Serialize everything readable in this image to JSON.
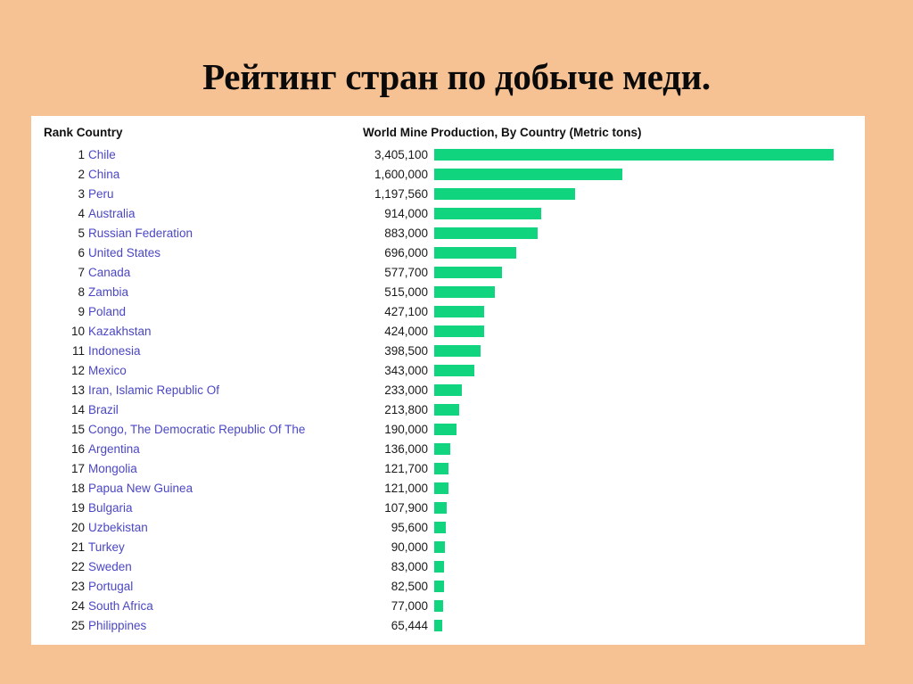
{
  "title": "Рейтинг стран по добыче меди.",
  "panel": {
    "headers": {
      "rank_country": "Rank Country",
      "production": "World Mine Production, By Country (Metric tons)"
    }
  },
  "colors": {
    "background": "#f7c293",
    "panel": "#ffffff",
    "bar": "#11d47e",
    "country_text": "#4b47c4",
    "value_text": "#1a1a1a",
    "header_text": "#111111",
    "title_text": "#0a0a0a"
  },
  "chart_data": {
    "type": "bar",
    "title": "Рейтинг стран по добыче меди.",
    "subtitle": "",
    "xlabel": "",
    "ylabel": "",
    "orientation": "horizontal",
    "grid": false,
    "legend": null,
    "value_header": "World Mine Production, By Country (Metric tons)",
    "category_header": "Rank Country",
    "units": "Metric tons",
    "xlim": [
      0,
      3405100
    ],
    "bar_color": "#11d47e",
    "categories": [
      "Chile",
      "China",
      "Peru",
      "Australia",
      "Russian Federation",
      "United States",
      "Canada",
      "Zambia",
      "Poland",
      "Kazakhstan",
      "Indonesia",
      "Mexico",
      "Iran, Islamic Republic Of",
      "Brazil",
      "Congo, The Democratic Republic Of The",
      "Argentina",
      "Mongolia",
      "Papua New Guinea",
      "Bulgaria",
      "Uzbekistan",
      "Turkey",
      "Sweden",
      "Portugal",
      "South Africa",
      "Philippines"
    ],
    "values": [
      3405100,
      1600000,
      1197560,
      914000,
      883000,
      696000,
      577700,
      515000,
      427100,
      424000,
      398500,
      343000,
      233000,
      213800,
      190000,
      136000,
      121700,
      121000,
      107900,
      95600,
      90000,
      83000,
      82500,
      77000,
      65444
    ],
    "rows": [
      {
        "rank": "1",
        "country": "Chile",
        "value": "3,405,100",
        "amount": 3405100
      },
      {
        "rank": "2",
        "country": "China",
        "value": "1,600,000",
        "amount": 1600000
      },
      {
        "rank": "3",
        "country": "Peru",
        "value": "1,197,560",
        "amount": 1197560
      },
      {
        "rank": "4",
        "country": "Australia",
        "value": "914,000",
        "amount": 914000
      },
      {
        "rank": "5",
        "country": "Russian Federation",
        "value": "883,000",
        "amount": 883000
      },
      {
        "rank": "6",
        "country": "United States",
        "value": "696,000",
        "amount": 696000
      },
      {
        "rank": "7",
        "country": "Canada",
        "value": "577,700",
        "amount": 577700
      },
      {
        "rank": "8",
        "country": "Zambia",
        "value": "515,000",
        "amount": 515000
      },
      {
        "rank": "9",
        "country": "Poland",
        "value": "427,100",
        "amount": 427100
      },
      {
        "rank": "10",
        "country": "Kazakhstan",
        "value": "424,000",
        "amount": 424000
      },
      {
        "rank": "11",
        "country": "Indonesia",
        "value": "398,500",
        "amount": 398500
      },
      {
        "rank": "12",
        "country": "Mexico",
        "value": "343,000",
        "amount": 343000
      },
      {
        "rank": "13",
        "country": "Iran, Islamic Republic Of",
        "value": "233,000",
        "amount": 233000
      },
      {
        "rank": "14",
        "country": "Brazil",
        "value": "213,800",
        "amount": 213800
      },
      {
        "rank": "15",
        "country": "Congo, The Democratic Republic Of The",
        "value": "190,000",
        "amount": 190000
      },
      {
        "rank": "16",
        "country": "Argentina",
        "value": "136,000",
        "amount": 136000
      },
      {
        "rank": "17",
        "country": "Mongolia",
        "value": "121,700",
        "amount": 121700
      },
      {
        "rank": "18",
        "country": "Papua New Guinea",
        "value": "121,000",
        "amount": 121000
      },
      {
        "rank": "19",
        "country": "Bulgaria",
        "value": "107,900",
        "amount": 107900
      },
      {
        "rank": "20",
        "country": "Uzbekistan",
        "value": "95,600",
        "amount": 95600
      },
      {
        "rank": "21",
        "country": "Turkey",
        "value": "90,000",
        "amount": 90000
      },
      {
        "rank": "22",
        "country": "Sweden",
        "value": "83,000",
        "amount": 83000
      },
      {
        "rank": "23",
        "country": "Portugal",
        "value": "82,500",
        "amount": 82500
      },
      {
        "rank": "24",
        "country": "South Africa",
        "value": "77,000",
        "amount": 77000
      },
      {
        "rank": "25",
        "country": "Philippines",
        "value": "65,444",
        "amount": 65444
      }
    ]
  }
}
